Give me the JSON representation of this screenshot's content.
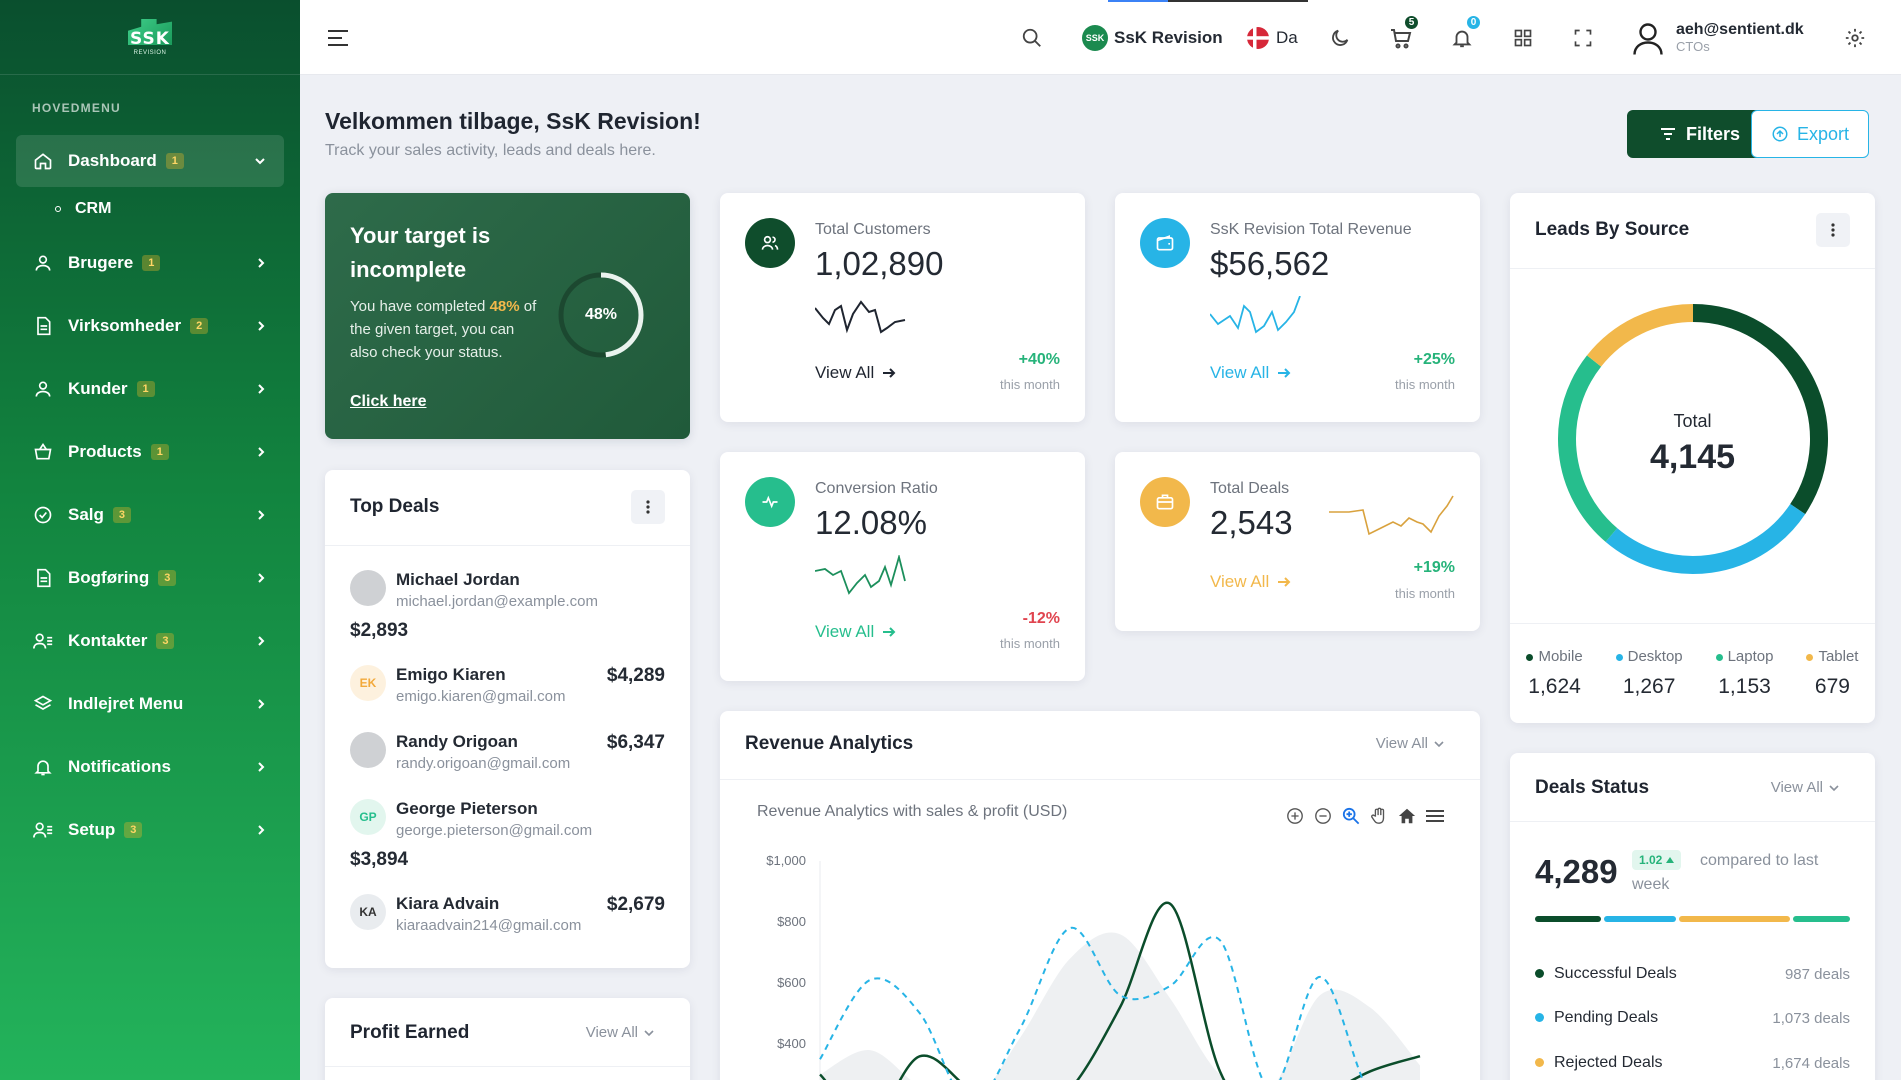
{
  "sidebar": {
    "logo_text": "SSK",
    "logo_sub": "REVISION",
    "menu_title": "HOVEDMENU",
    "items": [
      {
        "label": "Dashboard",
        "badge": "1"
      },
      {
        "label": "Brugere",
        "badge": "1"
      },
      {
        "label": "Virksomheder",
        "badge": "2"
      },
      {
        "label": "Kunder",
        "badge": "1"
      },
      {
        "label": "Products",
        "badge": "1"
      },
      {
        "label": "Salg",
        "badge": "3"
      },
      {
        "label": "Bogføring",
        "badge": "3"
      },
      {
        "label": "Kontakter",
        "badge": "3"
      },
      {
        "label": "Indlejret Menu"
      },
      {
        "label": "Notifications"
      },
      {
        "label": "Setup",
        "badge": "3"
      }
    ],
    "sub_item": "CRM"
  },
  "topbar": {
    "company": "SsK Revision",
    "language": "Da",
    "cart_count": "5",
    "notif_count": "0",
    "user_email": "aeh@sentient.dk",
    "user_role": "CTOs"
  },
  "page": {
    "title": "Velkommen tilbage, SsK Revision!",
    "subtitle": "Track your sales activity, leads and deals here.",
    "filters_label": "Filters",
    "export_label": "Export"
  },
  "target": {
    "title": "Your target is incomplete",
    "text_before": "You have completed",
    "percent": "48%",
    "text_after": "of the given target, you can also check your status.",
    "link": "Click here",
    "progress": 0.48
  },
  "stats": {
    "customers": {
      "label": "Total Customers",
      "value": "1,02,890",
      "link": "View All",
      "pct": "+40%",
      "sub": "this month"
    },
    "revenue": {
      "label": "SsK Revision Total Revenue",
      "value": "$56,562",
      "link": "View All",
      "pct": "+25%",
      "sub": "this month"
    },
    "conversion": {
      "label": "Conversion Ratio",
      "value": "12.08%",
      "link": "View All",
      "pct": "-12%",
      "sub": "this month"
    },
    "deals": {
      "label": "Total Deals",
      "value": "2,543",
      "link": "View All",
      "pct": "+19%",
      "sub": "this month"
    }
  },
  "top_deals": {
    "title": "Top Deals",
    "items": [
      {
        "name": "Michael Jordan",
        "email": "michael.jordan@example.com",
        "amount": "$2,893",
        "initials": ""
      },
      {
        "name": "Emigo Kiaren",
        "email": "emigo.kiaren@gmail.com",
        "amount": "$4,289",
        "initials": "EK"
      },
      {
        "name": "Randy Origoan",
        "email": "randy.origoan@gmail.com",
        "amount": "$6,347",
        "initials": ""
      },
      {
        "name": "George Pieterson",
        "email": "george.pieterson@gmail.com",
        "amount": "$3,894",
        "initials": "GP"
      },
      {
        "name": "Kiara Advain",
        "email": "kiaraadvain214@gmail.com",
        "amount": "$2,679",
        "initials": "KA"
      }
    ]
  },
  "profit": {
    "title": "Profit Earned",
    "view": "View All"
  },
  "revenue_analytics": {
    "title": "Revenue Analytics",
    "view": "View All",
    "subtitle": "Revenue Analytics with sales & profit (USD)"
  },
  "leads": {
    "title": "Leads By Source",
    "center_label": "Total",
    "center_value": "4,145",
    "sources": [
      {
        "name": "Mobile",
        "value": "1,624",
        "color": "#0b4d2b"
      },
      {
        "name": "Desktop",
        "value": "1,267",
        "color": "#27b4e6"
      },
      {
        "name": "Laptop",
        "value": "1,153",
        "color": "#26be8d"
      },
      {
        "name": "Tablet",
        "value": "679",
        "color": "#f2b84b"
      }
    ]
  },
  "deals_status": {
    "title": "Deals Status",
    "view": "View All",
    "value": "4,289",
    "badge": "1.02",
    "compare": "compared to last week",
    "rows": [
      {
        "label": "Successful Deals",
        "count": "987 deals",
        "color": "#0b4d2b"
      },
      {
        "label": "Pending Deals",
        "count": "1,073 deals",
        "color": "#27b4e6"
      },
      {
        "label": "Rejected Deals",
        "count": "1,674 deals",
        "color": "#f2b84b"
      }
    ]
  },
  "chart_data": {
    "type": "area",
    "title": "Revenue Analytics with sales & profit (USD)",
    "ylabel": "",
    "y_ticks": [
      "$1,000",
      "$800",
      "$600",
      "$400"
    ],
    "ylim": [
      300,
      1000
    ],
    "grid": false,
    "series": [
      {
        "values": [
          300,
          380,
          260,
          200,
          420,
          680,
          760,
          550,
          300,
          250,
          560,
          520,
          330
        ]
      },
      {
        "values": [
          300,
          150,
          360,
          250,
          140,
          250,
          520,
          860,
          310,
          120,
          220,
          310,
          360
        ]
      },
      {
        "values": [
          350,
          610,
          500,
          200,
          450,
          780,
          560,
          590,
          740,
          250,
          620,
          240,
          200
        ]
      }
    ]
  }
}
